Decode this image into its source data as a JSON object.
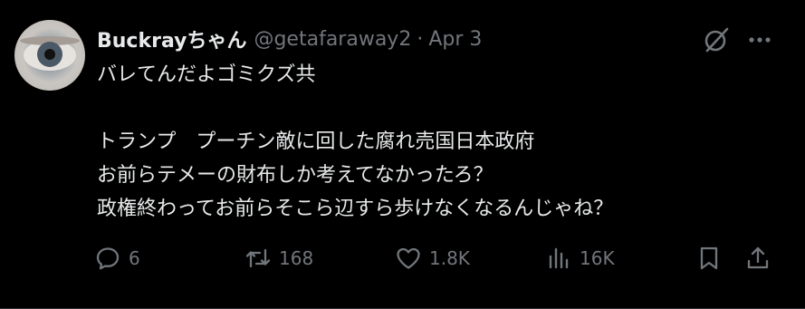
{
  "tweet": {
    "author_name": "Buckrayちゃん",
    "handle": "@getafaraway2",
    "separator": "·",
    "date": "Apr 3",
    "text": "バレてんだよゴミクズ共\n\nトランプ　プーチン敵に回した腐れ売国日本政府\nお前らテメーの財布しか考えてなかったろ？\n政権終わってお前らそこら辺すら歩けなくなるんじゃね？"
  },
  "actions": {
    "reply_count": "6",
    "retweet_count": "168",
    "like_count": "1.8K",
    "view_count": "16K"
  },
  "icons": {
    "avatar": "eye-closeup-avatar",
    "grok": "grok-icon",
    "more": "more-icon",
    "reply": "reply-icon",
    "retweet": "retweet-icon",
    "like": "heart-icon",
    "views": "views-icon",
    "bookmark": "bookmark-icon",
    "share": "share-icon"
  },
  "colors": {
    "background": "#000000",
    "text_primary": "#e7e9ea",
    "text_secondary": "#71767b"
  }
}
